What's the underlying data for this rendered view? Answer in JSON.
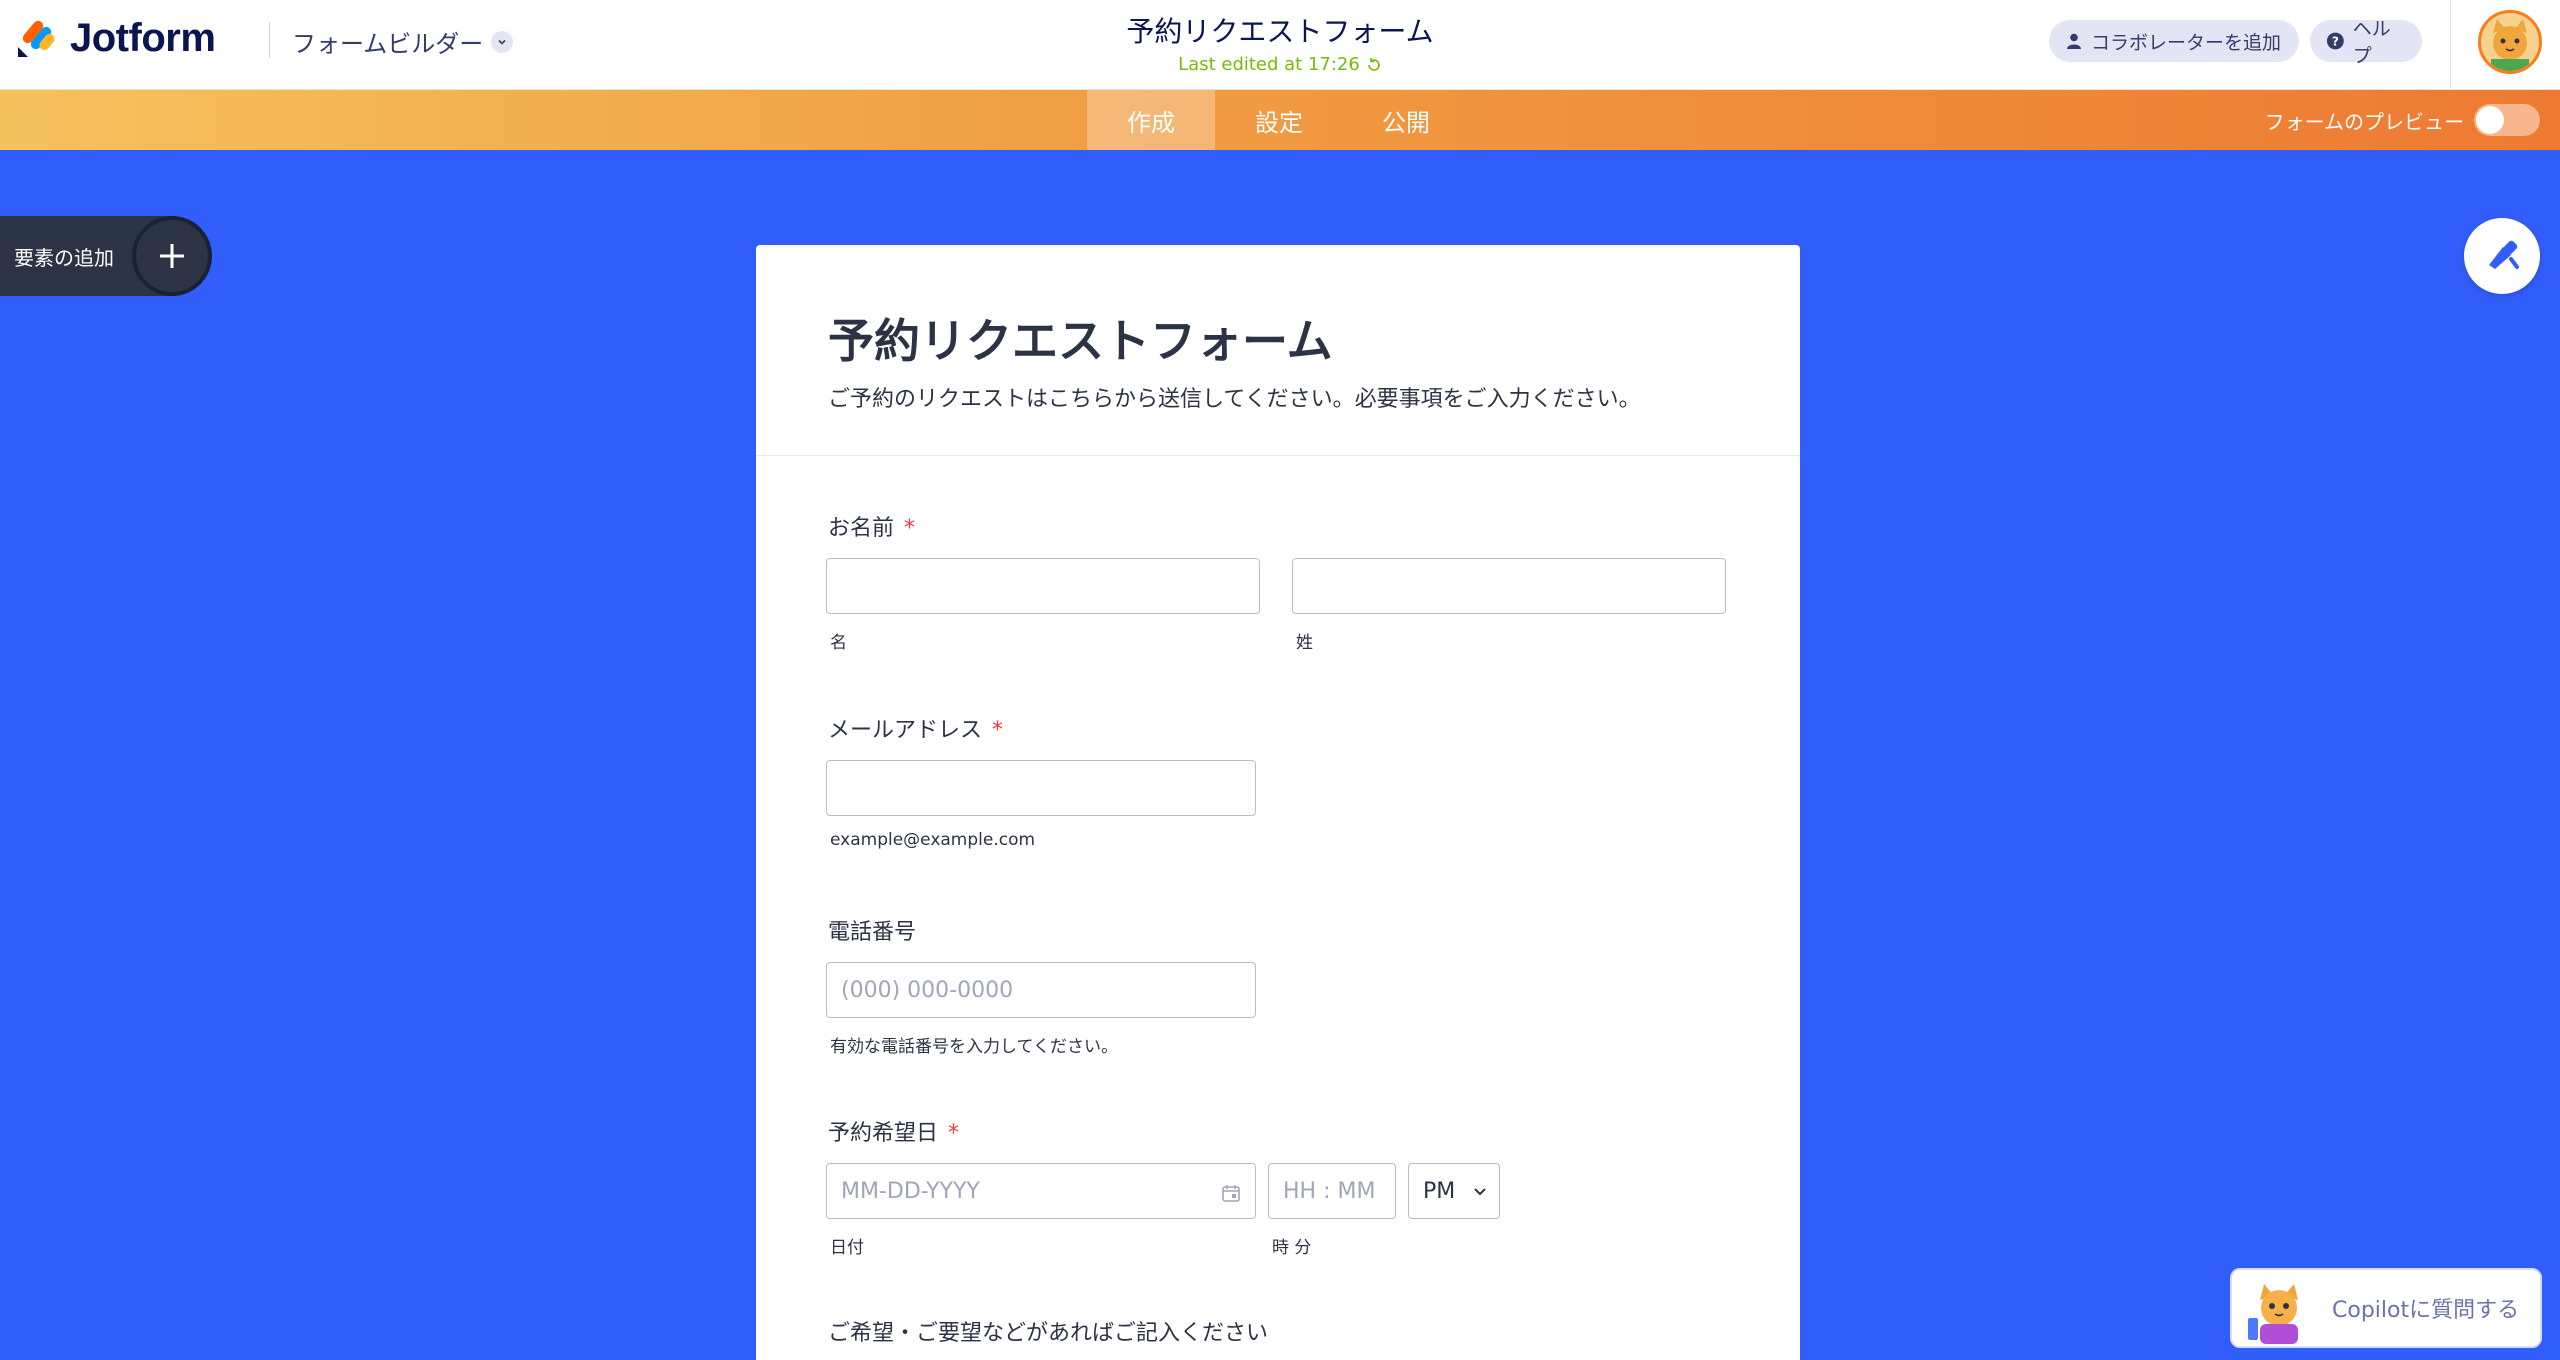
{
  "header": {
    "brand": "Jotform",
    "builder_menu": "フォームビルダー",
    "form_title": "予約リクエストフォーム",
    "last_edited": "Last edited at 17:26",
    "add_collaborator": "コラボレーターを追加",
    "help": "ヘルプ"
  },
  "nav": {
    "tabs": [
      {
        "label": "作成",
        "active": true
      },
      {
        "label": "設定",
        "active": false
      },
      {
        "label": "公開",
        "active": false
      }
    ],
    "preview_label": "フォームのプレビュー",
    "preview_on": false
  },
  "sidebar": {
    "add_element": "要素の追加"
  },
  "form": {
    "title": "予約リクエストフォーム",
    "description": "ご予約のリクエストはこちらから送信してください。必要事項をご入力ください。",
    "fields": {
      "name": {
        "label": "お名前",
        "required": "*",
        "first_sub": "名",
        "last_sub": "姓"
      },
      "email": {
        "label": "メールアドレス",
        "required": "*",
        "sub": "example@example.com"
      },
      "phone": {
        "label": "電話番号",
        "placeholder": "(000) 000-0000",
        "sub": "有効な電話番号を入力してください。"
      },
      "date": {
        "label": "予約希望日",
        "required": "*",
        "date_placeholder": "MM-DD-YYYY",
        "time_placeholder": "HH : MM",
        "ampm": "PM",
        "date_sub": "日付",
        "time_sub": "時 分"
      },
      "notes": {
        "label": "ご希望・ご要望などがあればご記入ください"
      }
    }
  },
  "copilot": {
    "label": "Copilotに質問する"
  },
  "colors": {
    "canvas_bg": "#315dfa",
    "brand_navy": "#0a1551",
    "required_red": "#f23a3c",
    "edited_green": "#78bb07"
  }
}
